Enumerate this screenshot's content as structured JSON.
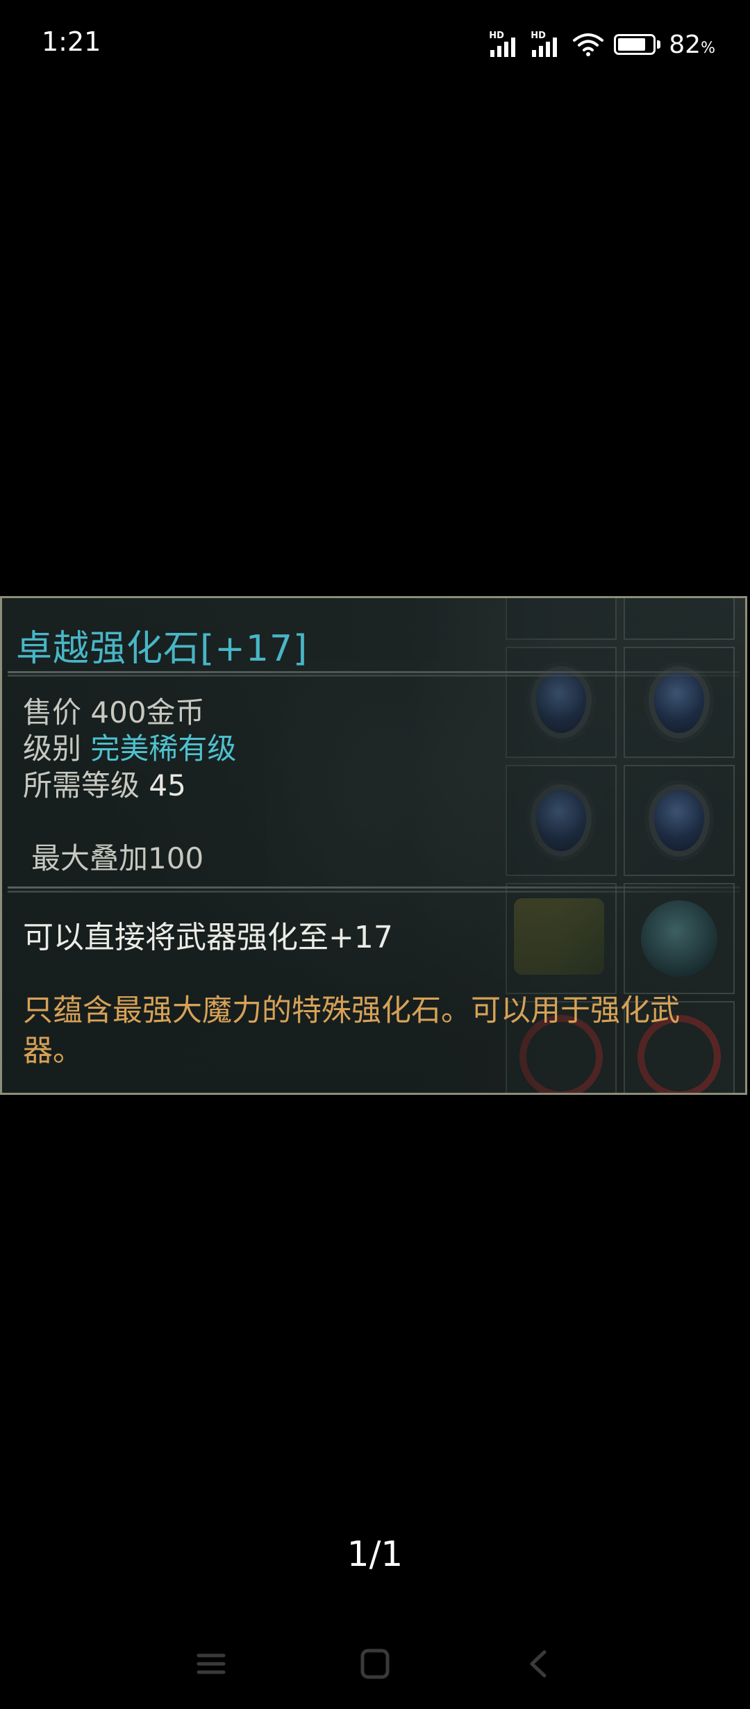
{
  "status_bar": {
    "time": "1:21",
    "signal1_label": "HD",
    "signal2_label": "HD",
    "battery_percent_value": 82,
    "battery_percent": "82",
    "battery_unit": "%"
  },
  "tooltip": {
    "title": "卓越强化石[+17]",
    "price_label": "售价",
    "price_value": "400金币",
    "grade_label": "级别",
    "grade_value": "完美稀有级",
    "req_level_label": "所需等级",
    "req_level_value": "45",
    "max_stack_label": "最大叠加",
    "max_stack_value": "100",
    "effect": "可以直接将武器强化至+17",
    "description": "只蕴含最强大魔力的特殊强化石。可以用于强化武器。"
  },
  "colors": {
    "title": "#49b6c6",
    "grade": "#4fc1cf",
    "description": "#d7a257"
  },
  "viewer": {
    "page_counter": "1/1"
  },
  "nav_bar": {
    "icons": [
      "menu-icon",
      "home-icon",
      "back-icon"
    ]
  }
}
